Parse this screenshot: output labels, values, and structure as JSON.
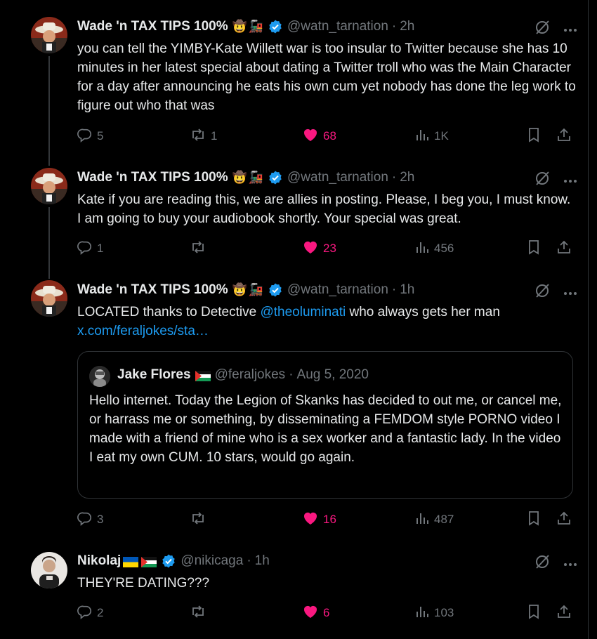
{
  "tweets": [
    {
      "name": "Wade 'n TAX TIPS 100%",
      "handle": "@watn_tarnation",
      "time": "2h",
      "text": "you can tell the YIMBY-Kate Willett war is too insular to Twitter because she has 10 minutes in her latest special about dating a Twitter troll who was the Main Character for a day after announcing he eats his own cum yet nobody has done the leg work to figure out who that was",
      "replies": "5",
      "reposts": "1",
      "likes": "68",
      "views": "1K"
    },
    {
      "name": "Wade 'n TAX TIPS 100%",
      "handle": "@watn_tarnation",
      "time": "2h",
      "text": "Kate if you are reading this, we are allies in posting. Please, I beg you, I must know. I am going to buy your audiobook shortly. Your special was great.",
      "replies": "1",
      "reposts": "",
      "likes": "23",
      "views": "456"
    },
    {
      "name": "Wade 'n TAX TIPS 100%",
      "handle": "@watn_tarnation",
      "time": "1h",
      "text_before": "LOCATED thanks to Detective ",
      "mention": "@theoluminati",
      "text_after": " who always gets her man",
      "link": "x.com/feraljokes/sta…",
      "quote": {
        "name": "Jake Flores",
        "handle": "@feraljokes",
        "date": "Aug 5, 2020",
        "text": "Hello internet. Today the Legion of Skanks has decided to out me, or cancel me, or harrass me or something, by disseminating a FEMDOM style PORNO video I made with a friend of mine who is a sex worker and a fantastic lady. In the video I eat my own CUM. 10 stars, would go again."
      },
      "replies": "3",
      "reposts": "",
      "likes": "16",
      "views": "487"
    },
    {
      "name": "Nikolaj",
      "handle": "@nikicaga",
      "time": "1h",
      "text": "THEY'RE DATING???",
      "replies": "2",
      "reposts": "",
      "likes": "6",
      "views": "103"
    }
  ],
  "separator": "·",
  "emojis": {
    "cowboy": "🤠",
    "train": "🚂"
  },
  "colors": {
    "accent": "#1d9bf0",
    "like": "#f91880",
    "muted": "#71767b",
    "text": "#e7e9ea",
    "border": "#2f3336"
  },
  "icons": [
    "reply-icon",
    "repost-icon",
    "heart-icon",
    "views-icon",
    "bookmark-icon",
    "share-icon",
    "grok-icon",
    "more-icon",
    "verified-badge-icon"
  ]
}
